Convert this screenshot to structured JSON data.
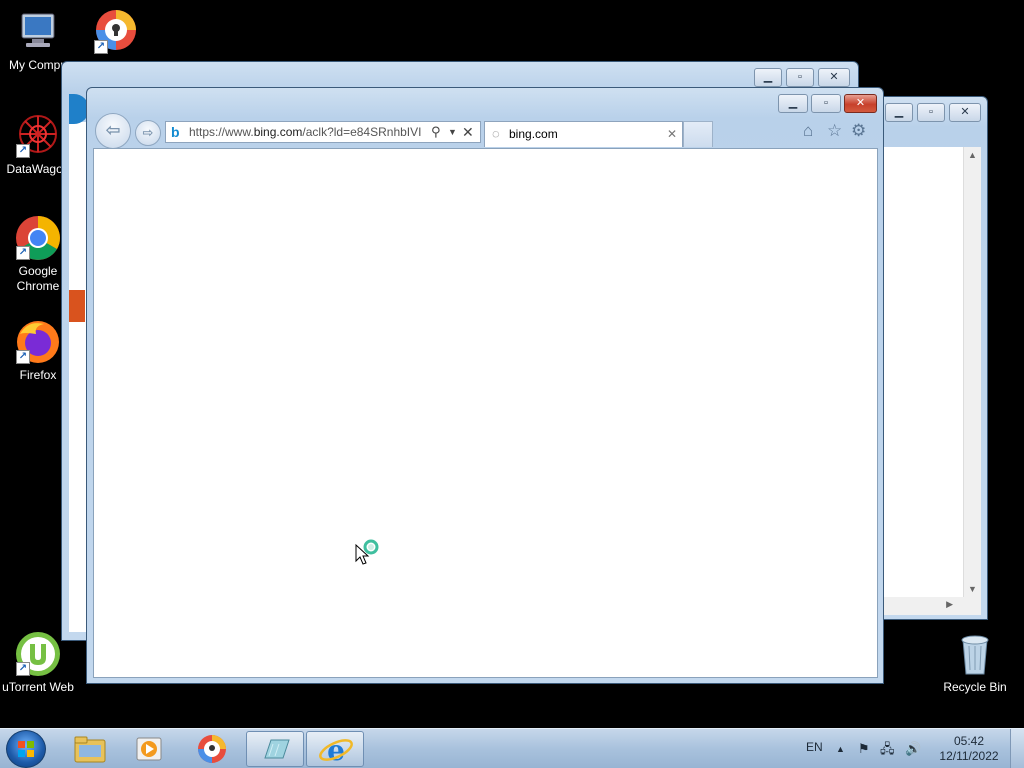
{
  "desktop": {
    "icons": [
      {
        "label": "My Compu",
        "icon": "computer-icon"
      },
      {
        "label": "",
        "icon": "browser-shield-icon"
      },
      {
        "label": "DataWagon",
        "icon": "datawagon-icon"
      },
      {
        "label": "Google\nChrome",
        "icon": "chrome-icon"
      },
      {
        "label": "Firefox",
        "icon": "firefox-icon"
      },
      {
        "label": "uTorrent Web",
        "icon": "utorrent-icon"
      },
      {
        "label": "Recycle Bin",
        "icon": "recycle-bin-icon"
      }
    ]
  },
  "ie_window": {
    "address_url_prefix": "https://www.",
    "address_url_domain": "bing.com",
    "address_url_rest": "/aclk?ld=e84SRnhbIVI",
    "tab_title": "bing.com"
  },
  "taskbar": {
    "language": "EN",
    "time": "05:42",
    "date": "12/11/2022"
  },
  "colors": {
    "window_frame": "#b9d1ea",
    "close_button": "#c7402b",
    "taskbar": "#a9c2dd"
  }
}
